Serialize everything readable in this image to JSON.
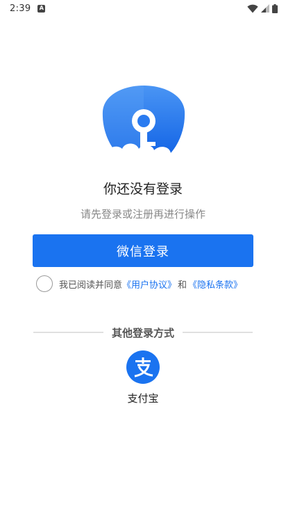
{
  "status_bar": {
    "time": "2:39",
    "notification_glyph": "A"
  },
  "login": {
    "title": "你还没有登录",
    "subtitle": "请先登录或注册再进行操作",
    "wechat_button": "微信登录"
  },
  "agreement": {
    "prefix": "我已阅读并同意",
    "user_agreement": "《用户协议》",
    "conjunction": "和",
    "privacy_policy": "《隐私条款》"
  },
  "other_login": {
    "heading": "其他登录方式",
    "alipay_label": "支付宝",
    "alipay_glyph": "支"
  },
  "colors": {
    "accent": "#1a73f0",
    "hero_blue": "#1a6fe8",
    "hero_light": "#d6e7fb"
  }
}
